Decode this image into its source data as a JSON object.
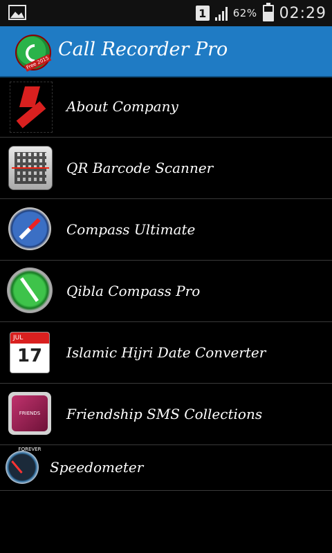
{
  "status_bar": {
    "sim_label": "1",
    "battery_percent": "62%",
    "battery_level": 0.62,
    "time": "02:29",
    "icons": [
      "image-notification-icon",
      "sim-icon",
      "signal-icon",
      "battery-icon"
    ]
  },
  "action_bar": {
    "title": "Call Recorder Pro",
    "logo_badge": "Free 2015"
  },
  "apps": [
    {
      "label": "About Company",
      "icon": "company-logo-icon"
    },
    {
      "label": "QR Barcode Scanner",
      "icon": "qr-scanner-icon"
    },
    {
      "label": "Compass Ultimate",
      "icon": "compass-icon"
    },
    {
      "label": "Qibla Compass Pro",
      "icon": "qibla-compass-icon"
    },
    {
      "label": "Islamic Hijri Date Converter",
      "icon": "calendar-icon",
      "icon_text": "17"
    },
    {
      "label": "Friendship SMS Collections",
      "icon": "friendship-sms-icon",
      "icon_text": "FRIENDS FOREVER"
    },
    {
      "label": "Speedometer",
      "icon": "speedometer-icon"
    }
  ]
}
